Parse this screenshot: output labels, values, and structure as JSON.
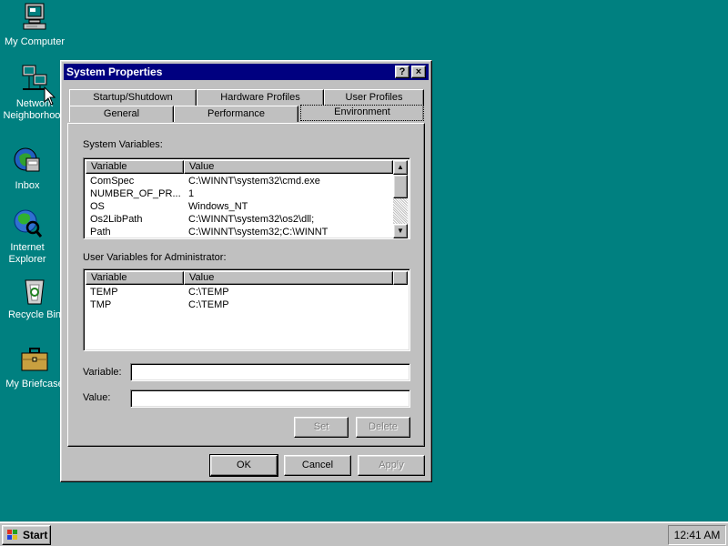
{
  "desktop": {
    "background": "#008080",
    "icons": [
      {
        "label": "My Computer",
        "icon": "computer-icon"
      },
      {
        "label": "Network\nNeighborhood",
        "icon": "network-icon"
      },
      {
        "label": "Inbox",
        "icon": "inbox-icon"
      },
      {
        "label": "Internet\nExplorer",
        "icon": "internet-explorer-icon"
      },
      {
        "label": "Recycle Bin",
        "icon": "recycle-bin-icon"
      },
      {
        "label": "My Briefcase",
        "icon": "briefcase-icon"
      }
    ]
  },
  "window": {
    "title": "System Properties",
    "help_label": "?",
    "close_label": "×",
    "title_color": "#000080",
    "tabs_row1": [
      "Startup/Shutdown",
      "Hardware Profiles",
      "User Profiles"
    ],
    "tabs_row2": [
      "General",
      "Performance",
      "Environment"
    ],
    "active_tab": "Environment",
    "system_vars": {
      "label": "System Variables:",
      "columns": [
        "Variable",
        "Value"
      ],
      "rows": [
        [
          "ComSpec",
          "C:\\WINNT\\system32\\cmd.exe"
        ],
        [
          "NUMBER_OF_PR...",
          "1"
        ],
        [
          "OS",
          "Windows_NT"
        ],
        [
          "Os2LibPath",
          "C:\\WINNT\\system32\\os2\\dll;"
        ],
        [
          "Path",
          "C:\\WINNT\\system32;C:\\WINNT"
        ]
      ]
    },
    "user_vars": {
      "label": "User Variables for Administrator:",
      "columns": [
        "Variable",
        "Value"
      ],
      "rows": [
        [
          "TEMP",
          "C:\\TEMP"
        ],
        [
          "TMP",
          "C:\\TEMP"
        ]
      ]
    },
    "variable_label": "Variable:",
    "variable_value": "",
    "value_label": "Value:",
    "value_value": "",
    "set_label": "Set",
    "delete_label": "Delete",
    "ok_label": "OK",
    "cancel_label": "Cancel",
    "apply_label": "Apply"
  },
  "taskbar": {
    "start_label": "Start",
    "clock": "12:41 AM"
  }
}
